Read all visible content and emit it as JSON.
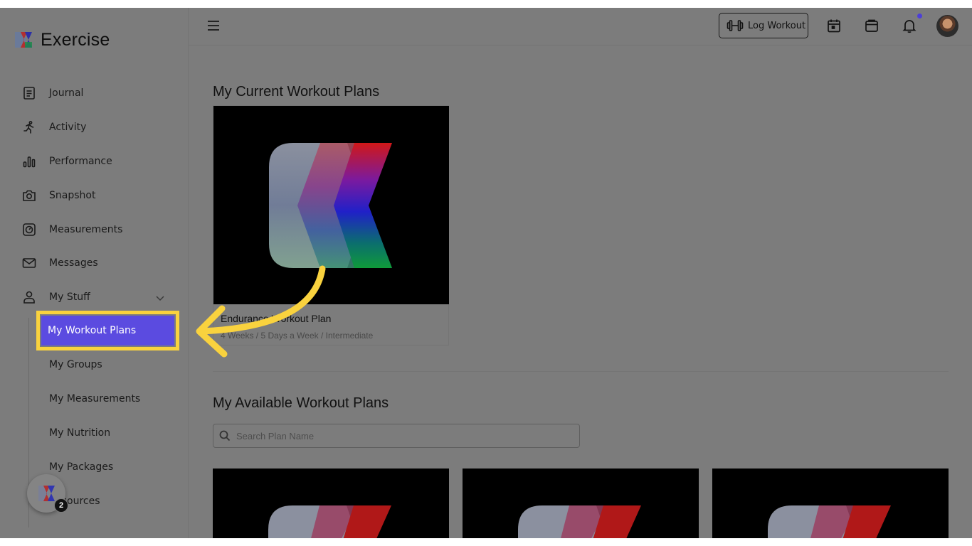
{
  "app": {
    "name": "Exercise"
  },
  "sidebar": {
    "items": [
      {
        "label": "Journal",
        "icon": "journal-icon"
      },
      {
        "label": "Activity",
        "icon": "running-icon"
      },
      {
        "label": "Performance",
        "icon": "bar-chart-icon"
      },
      {
        "label": "Snapshot",
        "icon": "camera-icon"
      },
      {
        "label": "Measurements",
        "icon": "scale-icon"
      },
      {
        "label": "Messages",
        "icon": "mail-icon"
      },
      {
        "label": "My Stuff",
        "icon": "user-icon"
      }
    ],
    "sub_items": [
      {
        "label": "My Workout Plans",
        "active": true
      },
      {
        "label": "My Groups"
      },
      {
        "label": "My Measurements"
      },
      {
        "label": "My Nutrition"
      },
      {
        "label": "My Packages"
      },
      {
        "label": "Resources"
      }
    ],
    "fab_badge": "2"
  },
  "header": {
    "log_workout_label": "Log Workout",
    "icons": [
      "calendar-icon",
      "store-icon",
      "bell-icon"
    ],
    "notification_dot": true
  },
  "main": {
    "current_title": "My Current Workout Plans",
    "current_plans": [
      {
        "title": "Endurance Workout Plan",
        "subtitle": "4 Weeks / 5 Days a Week / Intermediate"
      }
    ],
    "available_title": "My Available Workout Plans",
    "search_placeholder": "Search Plan Name"
  },
  "colors": {
    "accent": "#5b4be0",
    "highlight": "#f9d23e",
    "overlay_bg": "#7c7c7c"
  }
}
